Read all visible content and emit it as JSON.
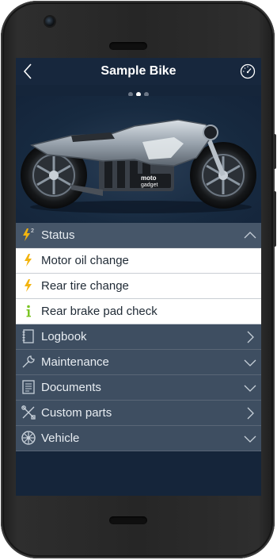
{
  "header": {
    "title": "Sample Bike",
    "back_icon": "chevron-left-icon",
    "gauge_icon": "speedometer-icon"
  },
  "carousel": {
    "dots": 3,
    "active_index": 1,
    "image": "motorcycle-photo"
  },
  "bike_image": {
    "badge_text_line1": "moto",
    "badge_text_line2": "gadget"
  },
  "status": {
    "label": "Status",
    "icon": "lightning-alert-icon",
    "badge_count": "2",
    "expanded": true,
    "items": [
      {
        "label": "Motor oil change",
        "icon": "lightning-icon",
        "icon_color": "#f3b40f"
      },
      {
        "label": "Rear tire change",
        "icon": "lightning-icon",
        "icon_color": "#f3b40f"
      },
      {
        "label": "Rear brake pad check",
        "icon": "info-icon",
        "icon_color": "#7cc425"
      }
    ]
  },
  "menu": [
    {
      "label": "Logbook",
      "icon": "notebook-icon",
      "chevron": "chevron-right-icon"
    },
    {
      "label": "Maintenance",
      "icon": "wrench-icon",
      "chevron": "chevron-down-icon"
    },
    {
      "label": "Documents",
      "icon": "document-icon",
      "chevron": "chevron-down-icon"
    },
    {
      "label": "Custom parts",
      "icon": "tools-icon",
      "chevron": "chevron-right-icon"
    },
    {
      "label": "Vehicle",
      "icon": "wheel-icon",
      "chevron": "chevron-down-icon"
    }
  ],
  "colors": {
    "screen_bg": "#15253a",
    "row_bg": "#3e4e61",
    "warning": "#f3b40f",
    "info": "#7cc425"
  }
}
